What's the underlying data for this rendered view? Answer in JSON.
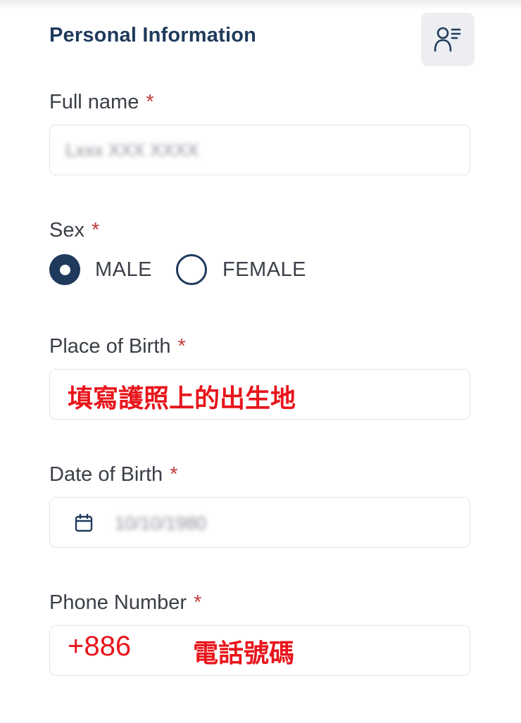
{
  "header": {
    "title": "Personal Information",
    "profile_icon": "user-list-icon"
  },
  "required_marker": "*",
  "full_name": {
    "label": "Full name",
    "value": "Lxxx XXX XXXX"
  },
  "sex": {
    "label": "Sex",
    "options": [
      {
        "label": "MALE",
        "selected": true
      },
      {
        "label": "FEMALE",
        "selected": false
      }
    ]
  },
  "place_of_birth": {
    "label": "Place of Birth",
    "annotation": "填寫護照上的出生地"
  },
  "date_of_birth": {
    "label": "Date of Birth",
    "icon": "calendar-icon",
    "value": "10/10/1980"
  },
  "phone_number": {
    "label": "Phone Number",
    "annotation_code": "+886",
    "annotation": "電話號碼"
  },
  "colors": {
    "primary": "#1f3a5c",
    "required": "#c43c3c",
    "annotation": "#e8141b",
    "border": "#e4e6ea",
    "icon_button_bg": "#eceef1"
  }
}
